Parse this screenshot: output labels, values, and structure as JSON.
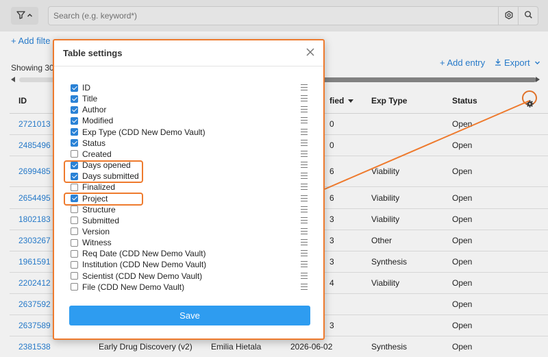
{
  "toolbar": {
    "search_placeholder": "Search (e.g. keyword*)",
    "add_filter": "+ Add filte",
    "showing": "Showing 30",
    "add_entry": "+ Add entry",
    "export": "Export"
  },
  "table": {
    "headers": {
      "id": "ID",
      "modified": "fied",
      "exp_type": "Exp Type",
      "status": "Status"
    },
    "rows": [
      {
        "id": "2721013",
        "modified": "0",
        "exp_type": "",
        "status": "Open"
      },
      {
        "id": "2485496",
        "modified": "0",
        "exp_type": "",
        "status": "Open"
      },
      {
        "id": "2699485",
        "modified": "6",
        "exp_type": "Viability",
        "status": "Open"
      },
      {
        "id": "2654495",
        "modified": "6",
        "exp_type": "Viability",
        "status": "Open"
      },
      {
        "id": "1802183",
        "modified": "3",
        "exp_type": "Viability",
        "status": "Open"
      },
      {
        "id": "2303267",
        "modified": "3",
        "exp_type": "Other",
        "status": "Open"
      },
      {
        "id": "1961591",
        "modified": "3",
        "exp_type": "Synthesis",
        "status": "Open"
      },
      {
        "id": "2202412",
        "modified": "4",
        "exp_type": "Viability",
        "status": "Open"
      },
      {
        "id": "2637592",
        "modified": "",
        "exp_type": "",
        "status": "Open"
      },
      {
        "id": "2637589",
        "modified": "3",
        "exp_type": "",
        "status": "Open"
      },
      {
        "id": "2381538",
        "project": "Early Drug Discovery (v2)",
        "author": "Emilia Hietala",
        "modified": "2026-06-02",
        "exp_type": "Synthesis",
        "status": "Open"
      }
    ]
  },
  "modal": {
    "title": "Table settings",
    "save_label": "Save",
    "options": [
      {
        "label": "ID",
        "checked": true
      },
      {
        "label": "Title",
        "checked": true
      },
      {
        "label": "Author",
        "checked": true
      },
      {
        "label": "Modified",
        "checked": true
      },
      {
        "label": "Exp Type (CDD New Demo Vault)",
        "checked": true
      },
      {
        "label": "Status",
        "checked": true
      },
      {
        "label": "Created",
        "checked": false
      },
      {
        "label": "Days opened",
        "checked": true
      },
      {
        "label": "Days submitted",
        "checked": true
      },
      {
        "label": "Finalized",
        "checked": false
      },
      {
        "label": "Project",
        "checked": true
      },
      {
        "label": "Structure",
        "checked": false
      },
      {
        "label": "Submitted",
        "checked": false
      },
      {
        "label": "Version",
        "checked": false
      },
      {
        "label": "Witness",
        "checked": false
      },
      {
        "label": "Req Date (CDD New Demo Vault)",
        "checked": false
      },
      {
        "label": "Institution (CDD New Demo Vault)",
        "checked": false
      },
      {
        "label": "Scientist (CDD New Demo Vault)",
        "checked": false
      },
      {
        "label": "File (CDD New Demo Vault)",
        "checked": false
      }
    ]
  },
  "colors": {
    "accent": "#2a82d6",
    "highlight": "#ee7a2d",
    "save_button": "#2e9cf0"
  }
}
